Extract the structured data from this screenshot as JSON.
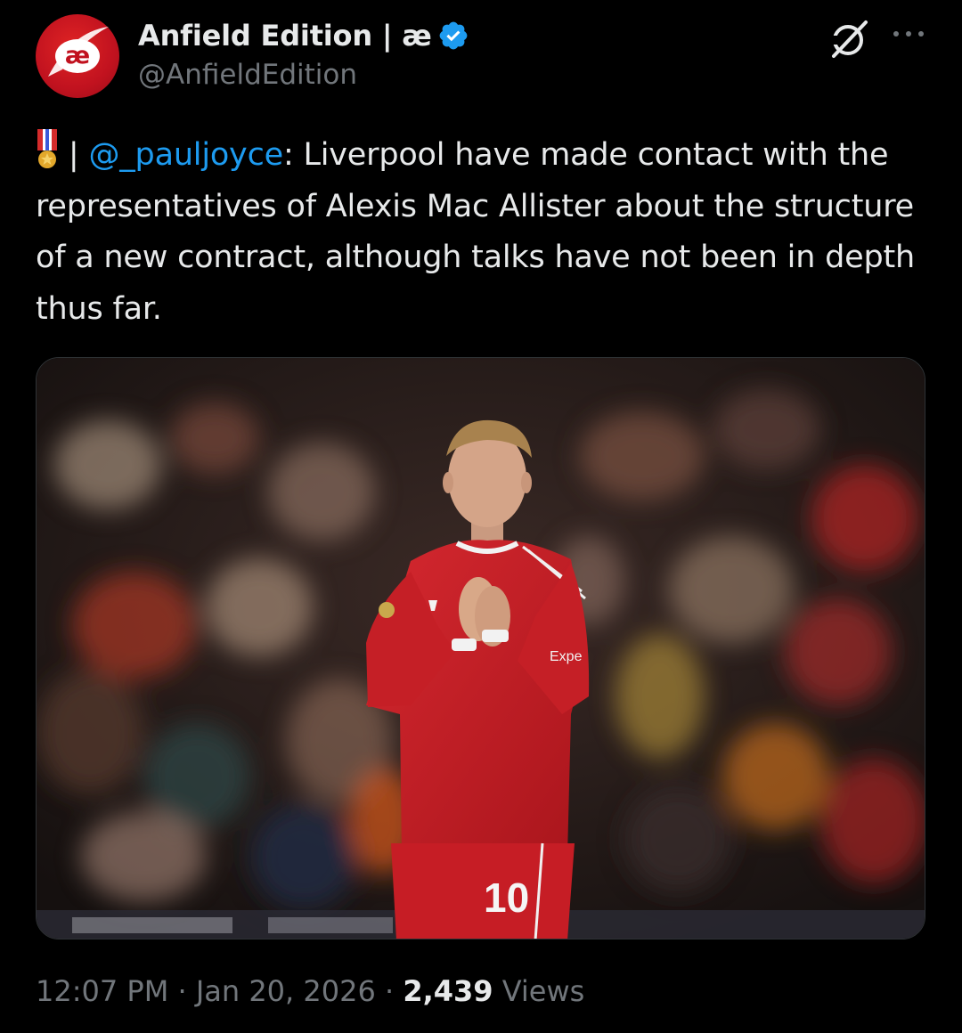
{
  "author": {
    "display_name": "Anfield Edition | æ",
    "handle": "@AnfieldEdition",
    "avatar_icon": "anfield-edition-logo",
    "avatar_text": "æ",
    "verified": true,
    "verified_color": "#1d9bf0"
  },
  "actions": {
    "grok_icon": "grok-icon",
    "more_icon": "more-dots-icon"
  },
  "tweet": {
    "emoji": "medal-icon",
    "separator": " | ",
    "mention": "@_pauljoyce",
    "text": ": Liverpool have made contact with the representatives of Alexis Mac Allister about the structure of a new contract, although talks have not been in depth thus far."
  },
  "media": {
    "kit_sponsor": "Expe",
    "shirt_number": "10"
  },
  "meta": {
    "time": "12:07 PM",
    "dot1": " · ",
    "date": "Jan 20, 2026",
    "dot2": " · ",
    "views_count": "2,439",
    "views_label": " Views"
  },
  "colors": {
    "background": "#000000",
    "text": "#e7e9ea",
    "secondary": "#71767b",
    "link": "#1d9bf0",
    "brand_red": "#c1121f"
  }
}
